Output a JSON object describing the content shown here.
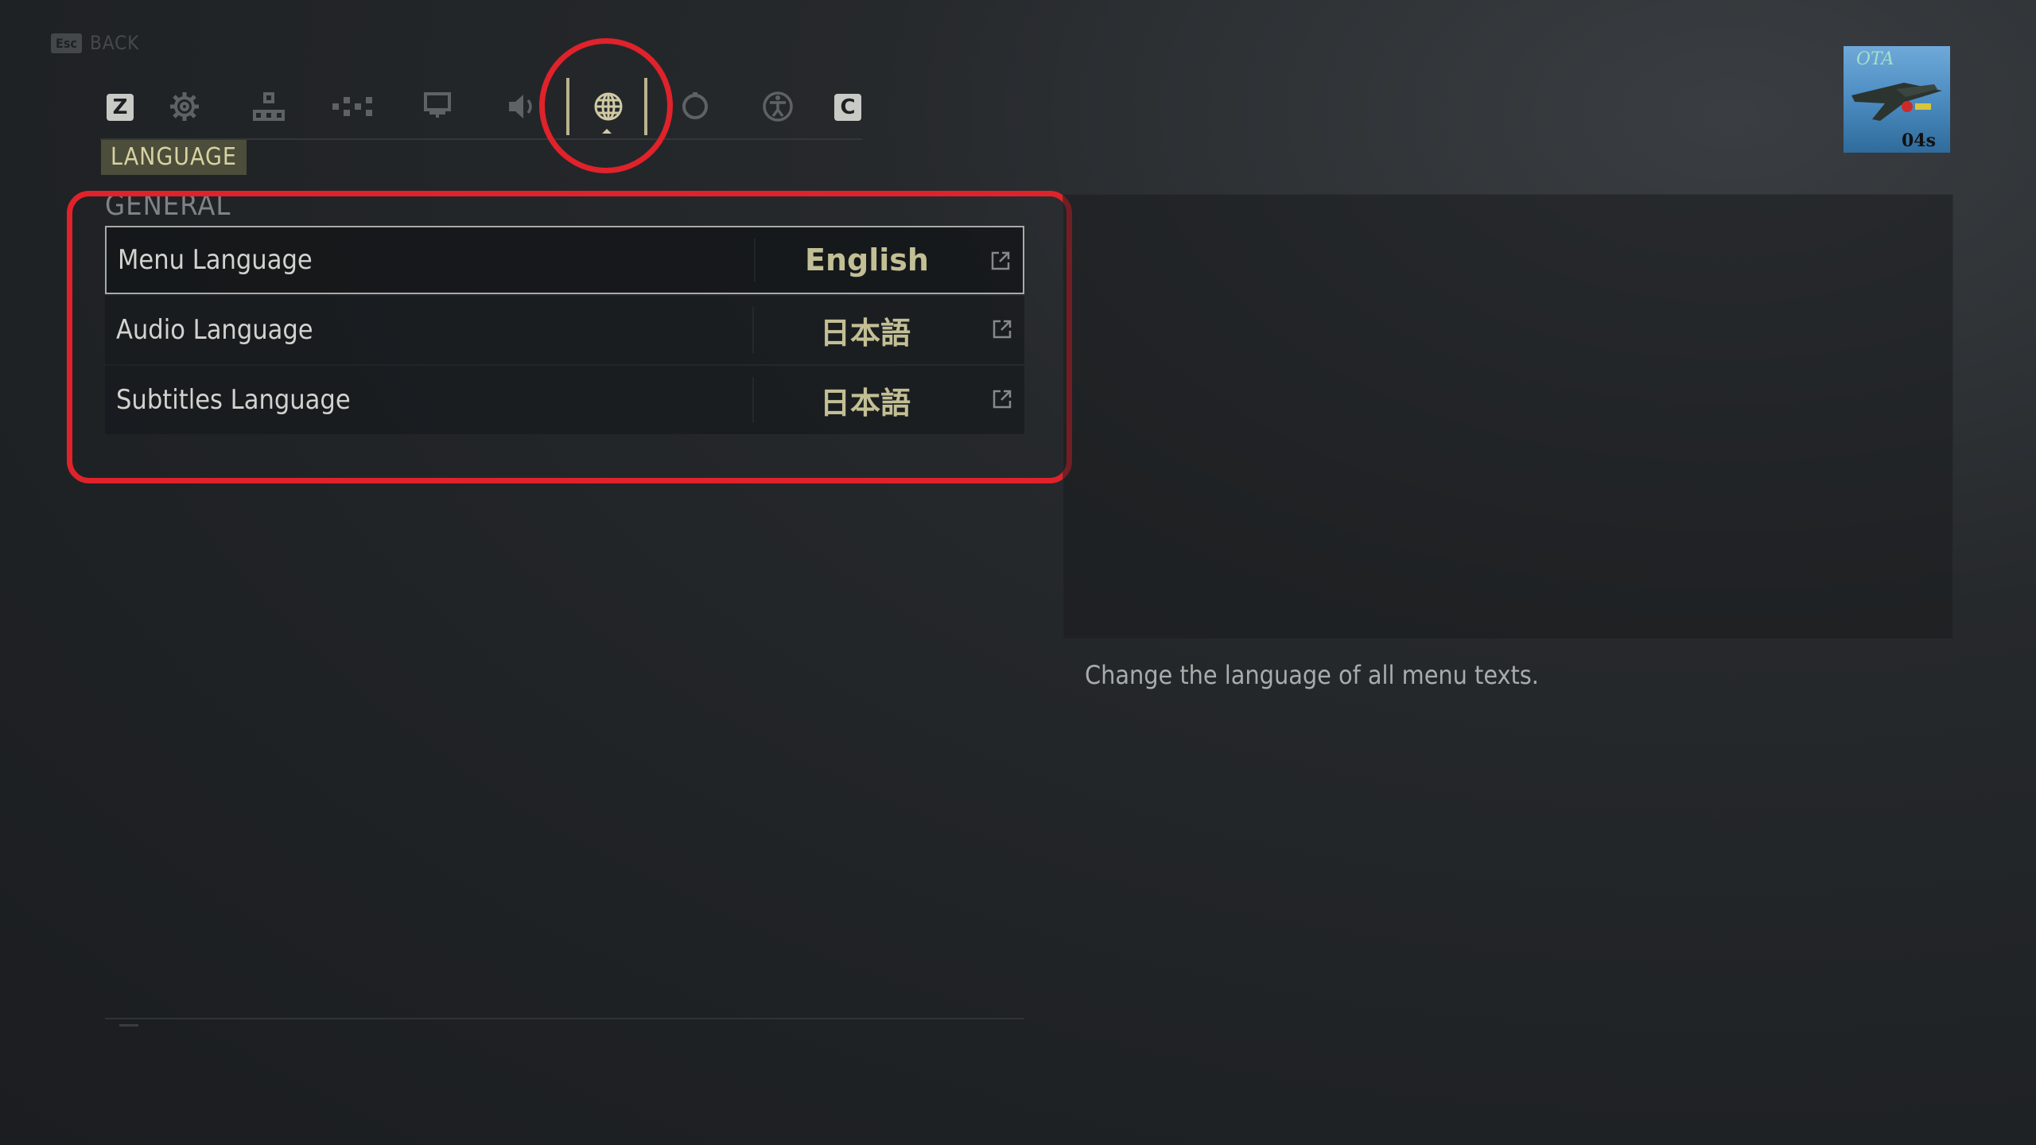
{
  "back": {
    "key": "Esc",
    "label": "BACK"
  },
  "tabs": {
    "left_hotkey": "Z",
    "right_hotkey": "C",
    "icons": [
      "gear-icon",
      "hierarchy-icon",
      "network-icon",
      "monitor-icon",
      "speaker-icon",
      "globe-icon",
      "controller-icon",
      "accessibility-icon"
    ],
    "active": "globe-icon"
  },
  "section": {
    "label": "LANGUAGE"
  },
  "group": {
    "title": "GENERAL"
  },
  "settings": [
    {
      "label": "Menu Language",
      "value": "English"
    },
    {
      "label": "Audio Language",
      "value": "日本語"
    },
    {
      "label": "Subtitles Language",
      "value": "日本語"
    }
  ],
  "description": "Change the language of all menu texts.",
  "thumbnail": {
    "caption": "OTA",
    "timer": "04s"
  },
  "colors": {
    "accent": "#b9b48f",
    "annotation": "#e0222b",
    "section_bg": "#4c4d3a"
  }
}
